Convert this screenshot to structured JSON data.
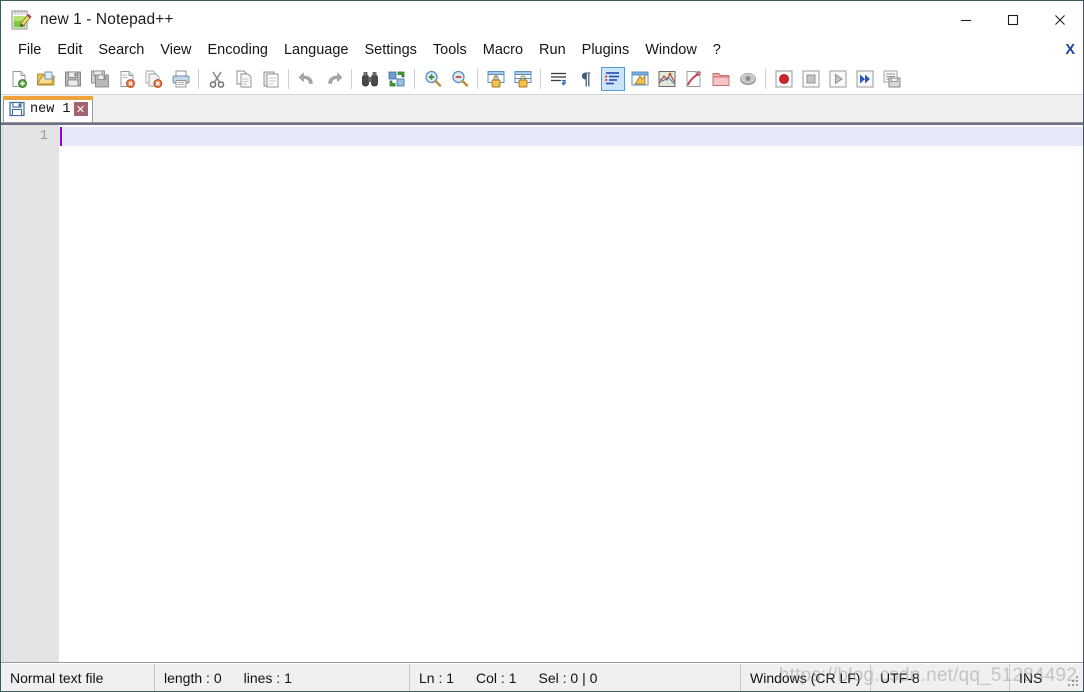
{
  "window": {
    "title": "new 1 - Notepad++",
    "app_icon": "notepad-plus-plus-icon",
    "controls": {
      "minimize": "—",
      "maximize": "□",
      "close": "✕"
    }
  },
  "menubar": {
    "items": [
      {
        "label": "File",
        "name": "menu-file"
      },
      {
        "label": "Edit",
        "name": "menu-edit"
      },
      {
        "label": "Search",
        "name": "menu-search"
      },
      {
        "label": "View",
        "name": "menu-view"
      },
      {
        "label": "Encoding",
        "name": "menu-encoding"
      },
      {
        "label": "Language",
        "name": "menu-language"
      },
      {
        "label": "Settings",
        "name": "menu-settings"
      },
      {
        "label": "Tools",
        "name": "menu-tools"
      },
      {
        "label": "Macro",
        "name": "menu-macro"
      },
      {
        "label": "Run",
        "name": "menu-run"
      },
      {
        "label": "Plugins",
        "name": "menu-plugins"
      },
      {
        "label": "Window",
        "name": "menu-window"
      },
      {
        "label": "?",
        "name": "menu-help"
      }
    ],
    "close_document": "X"
  },
  "toolbar": {
    "buttons": [
      {
        "icon": "new-file-icon",
        "title": "New"
      },
      {
        "icon": "open-folder-icon",
        "title": "Open"
      },
      {
        "icon": "save-icon",
        "title": "Save"
      },
      {
        "icon": "save-all-icon",
        "title": "Save All"
      },
      {
        "icon": "close-document-icon",
        "title": "Close"
      },
      {
        "icon": "close-all-documents-icon",
        "title": "Close All"
      },
      {
        "icon": "print-icon",
        "title": "Print"
      },
      {
        "icon": "separator",
        "title": ""
      },
      {
        "icon": "cut-scissors-icon",
        "title": "Cut"
      },
      {
        "icon": "copy-icon",
        "title": "Copy"
      },
      {
        "icon": "paste-icon",
        "title": "Paste"
      },
      {
        "icon": "separator",
        "title": ""
      },
      {
        "icon": "undo-icon",
        "title": "Undo"
      },
      {
        "icon": "redo-icon",
        "title": "Redo"
      },
      {
        "icon": "separator",
        "title": ""
      },
      {
        "icon": "find-binoculars-icon",
        "title": "Find"
      },
      {
        "icon": "replace-icon",
        "title": "Replace"
      },
      {
        "icon": "separator",
        "title": ""
      },
      {
        "icon": "zoom-in-icon",
        "title": "Zoom In"
      },
      {
        "icon": "zoom-out-icon",
        "title": "Zoom Out"
      },
      {
        "icon": "separator",
        "title": ""
      },
      {
        "icon": "sync-vertical-scroll-icon",
        "title": "Synchronize Vertical Scrolling"
      },
      {
        "icon": "sync-horizontal-scroll-icon",
        "title": "Synchronize Horizontal Scrolling"
      },
      {
        "icon": "separator",
        "title": ""
      },
      {
        "icon": "word-wrap-icon",
        "title": "Word Wrap"
      },
      {
        "icon": "show-symbol-pilcrow-icon",
        "title": "Show All Characters"
      },
      {
        "icon": "show-indent-guide-icon",
        "title": "Show Indent Guide",
        "active": true
      },
      {
        "icon": "user-defined-dialog-icon",
        "title": "User-Defined Dialogue"
      },
      {
        "icon": "document-map-icon",
        "title": "Document Map"
      },
      {
        "icon": "function-list-icon",
        "title": "Function List"
      },
      {
        "icon": "folder-as-workspace-icon",
        "title": "Folder as Workspace"
      },
      {
        "icon": "monitoring-icon",
        "title": "Monitoring"
      },
      {
        "icon": "separator",
        "title": ""
      },
      {
        "icon": "macro-record-icon",
        "title": "Start Recording"
      },
      {
        "icon": "macro-stop-icon",
        "title": "Stop Recording"
      },
      {
        "icon": "macro-play-icon",
        "title": "Playback"
      },
      {
        "icon": "macro-run-multiple-icon",
        "title": "Run a Macro Multiple Times"
      },
      {
        "icon": "macro-save-icon",
        "title": "Save Current Recorded Macro"
      }
    ]
  },
  "tabs": [
    {
      "label": "new 1",
      "icon": "save-floppy-blue-icon",
      "close": "✕",
      "active": true
    }
  ],
  "editor": {
    "line_numbers": [
      "1"
    ],
    "lines": [
      ""
    ],
    "caret": "text-caret"
  },
  "statusbar": {
    "file_type": "Normal text file",
    "length_label": "length : 0",
    "lines_label": "lines : 1",
    "ln": "Ln : 1",
    "col": "Col : 1",
    "sel": "Sel : 0 | 0",
    "eol": "Windows (CR LF)",
    "encoding": "UTF-8",
    "insert_mode": "INS"
  },
  "watermark": {
    "text": "https://blog.csdn.net/qq_51284492"
  },
  "colors": {
    "tab_accent": "#f0a13c",
    "current_line": "#e8e8fb",
    "caret": "#9a00d4",
    "gutter": "#e4e4e4",
    "statusbar": "#f0f0f0",
    "active_tool": "#cce4f7"
  }
}
